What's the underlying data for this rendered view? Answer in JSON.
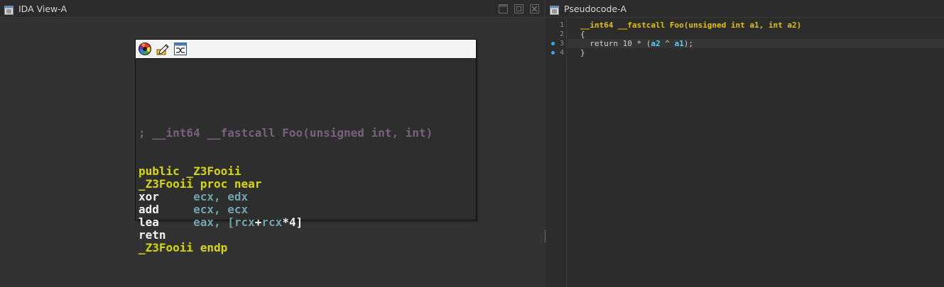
{
  "ida_view": {
    "title": "IDA View-A",
    "node": {
      "comment": "; __int64 __fastcall Foo(unsigned int, int)",
      "lines": [
        {
          "parts": [
            {
              "t": "public _Z3Fooii",
              "c": "c-yellow"
            }
          ]
        },
        {
          "parts": [
            {
              "t": "_Z3Fooii proc near",
              "c": "c-yellow"
            }
          ]
        },
        {
          "parts": [
            {
              "t": "xor     ",
              "c": "c-white"
            },
            {
              "t": "ecx, edx",
              "c": "c-reg"
            }
          ]
        },
        {
          "parts": [
            {
              "t": "add     ",
              "c": "c-white"
            },
            {
              "t": "ecx, ecx",
              "c": "c-reg"
            }
          ]
        },
        {
          "parts": [
            {
              "t": "lea     ",
              "c": "c-white"
            },
            {
              "t": "eax, [",
              "c": "c-reg"
            },
            {
              "t": "rcx",
              "c": "c-reg"
            },
            {
              "t": "+",
              "c": "c-white"
            },
            {
              "t": "rcx",
              "c": "c-reg"
            },
            {
              "t": "*4]",
              "c": "c-white"
            }
          ]
        },
        {
          "parts": [
            {
              "t": "retn",
              "c": "c-white"
            }
          ]
        },
        {
          "parts": [
            {
              "t": "_Z3Fooii endp",
              "c": "c-yellow"
            }
          ]
        }
      ],
      "header_icons": [
        "color-palette-icon",
        "edit-pencil-icon",
        "graph-layout-icon"
      ]
    },
    "window_icons": [
      "minimize-icon",
      "maximize-icon",
      "close-icon"
    ]
  },
  "pseudocode": {
    "title": "Pseudocode-A",
    "lines": [
      {
        "num": "1",
        "bp": false,
        "parts": [
          {
            "t": "__int64 __fastcall Foo(unsigned int a1, int a2)",
            "c": "k-type"
          }
        ]
      },
      {
        "num": "2",
        "bp": false,
        "parts": [
          {
            "t": "{",
            "c": "k-plain"
          }
        ]
      },
      {
        "num": "3",
        "bp": true,
        "highlight": true,
        "parts": [
          {
            "t": "  return 10 * (",
            "c": "k-plain"
          },
          {
            "t": "a2",
            "c": "k-var"
          },
          {
            "t": " ^ ",
            "c": "k-plain"
          },
          {
            "t": "a1",
            "c": "k-var"
          },
          {
            "t": ");",
            "c": "k-plain"
          }
        ]
      },
      {
        "num": "4",
        "bp": true,
        "parts": [
          {
            "t": "}",
            "c": "k-plain"
          }
        ]
      }
    ]
  },
  "colors": {
    "background": "#323232",
    "comment": "#7a5f7e",
    "label": "#d8d800",
    "mnemonic": "#f4f4f4",
    "register": "#6fa3ad",
    "breakpoint": "#3aa7e6",
    "pseudo_type": "#e5c100",
    "pseudo_var": "#4fd0ff"
  }
}
